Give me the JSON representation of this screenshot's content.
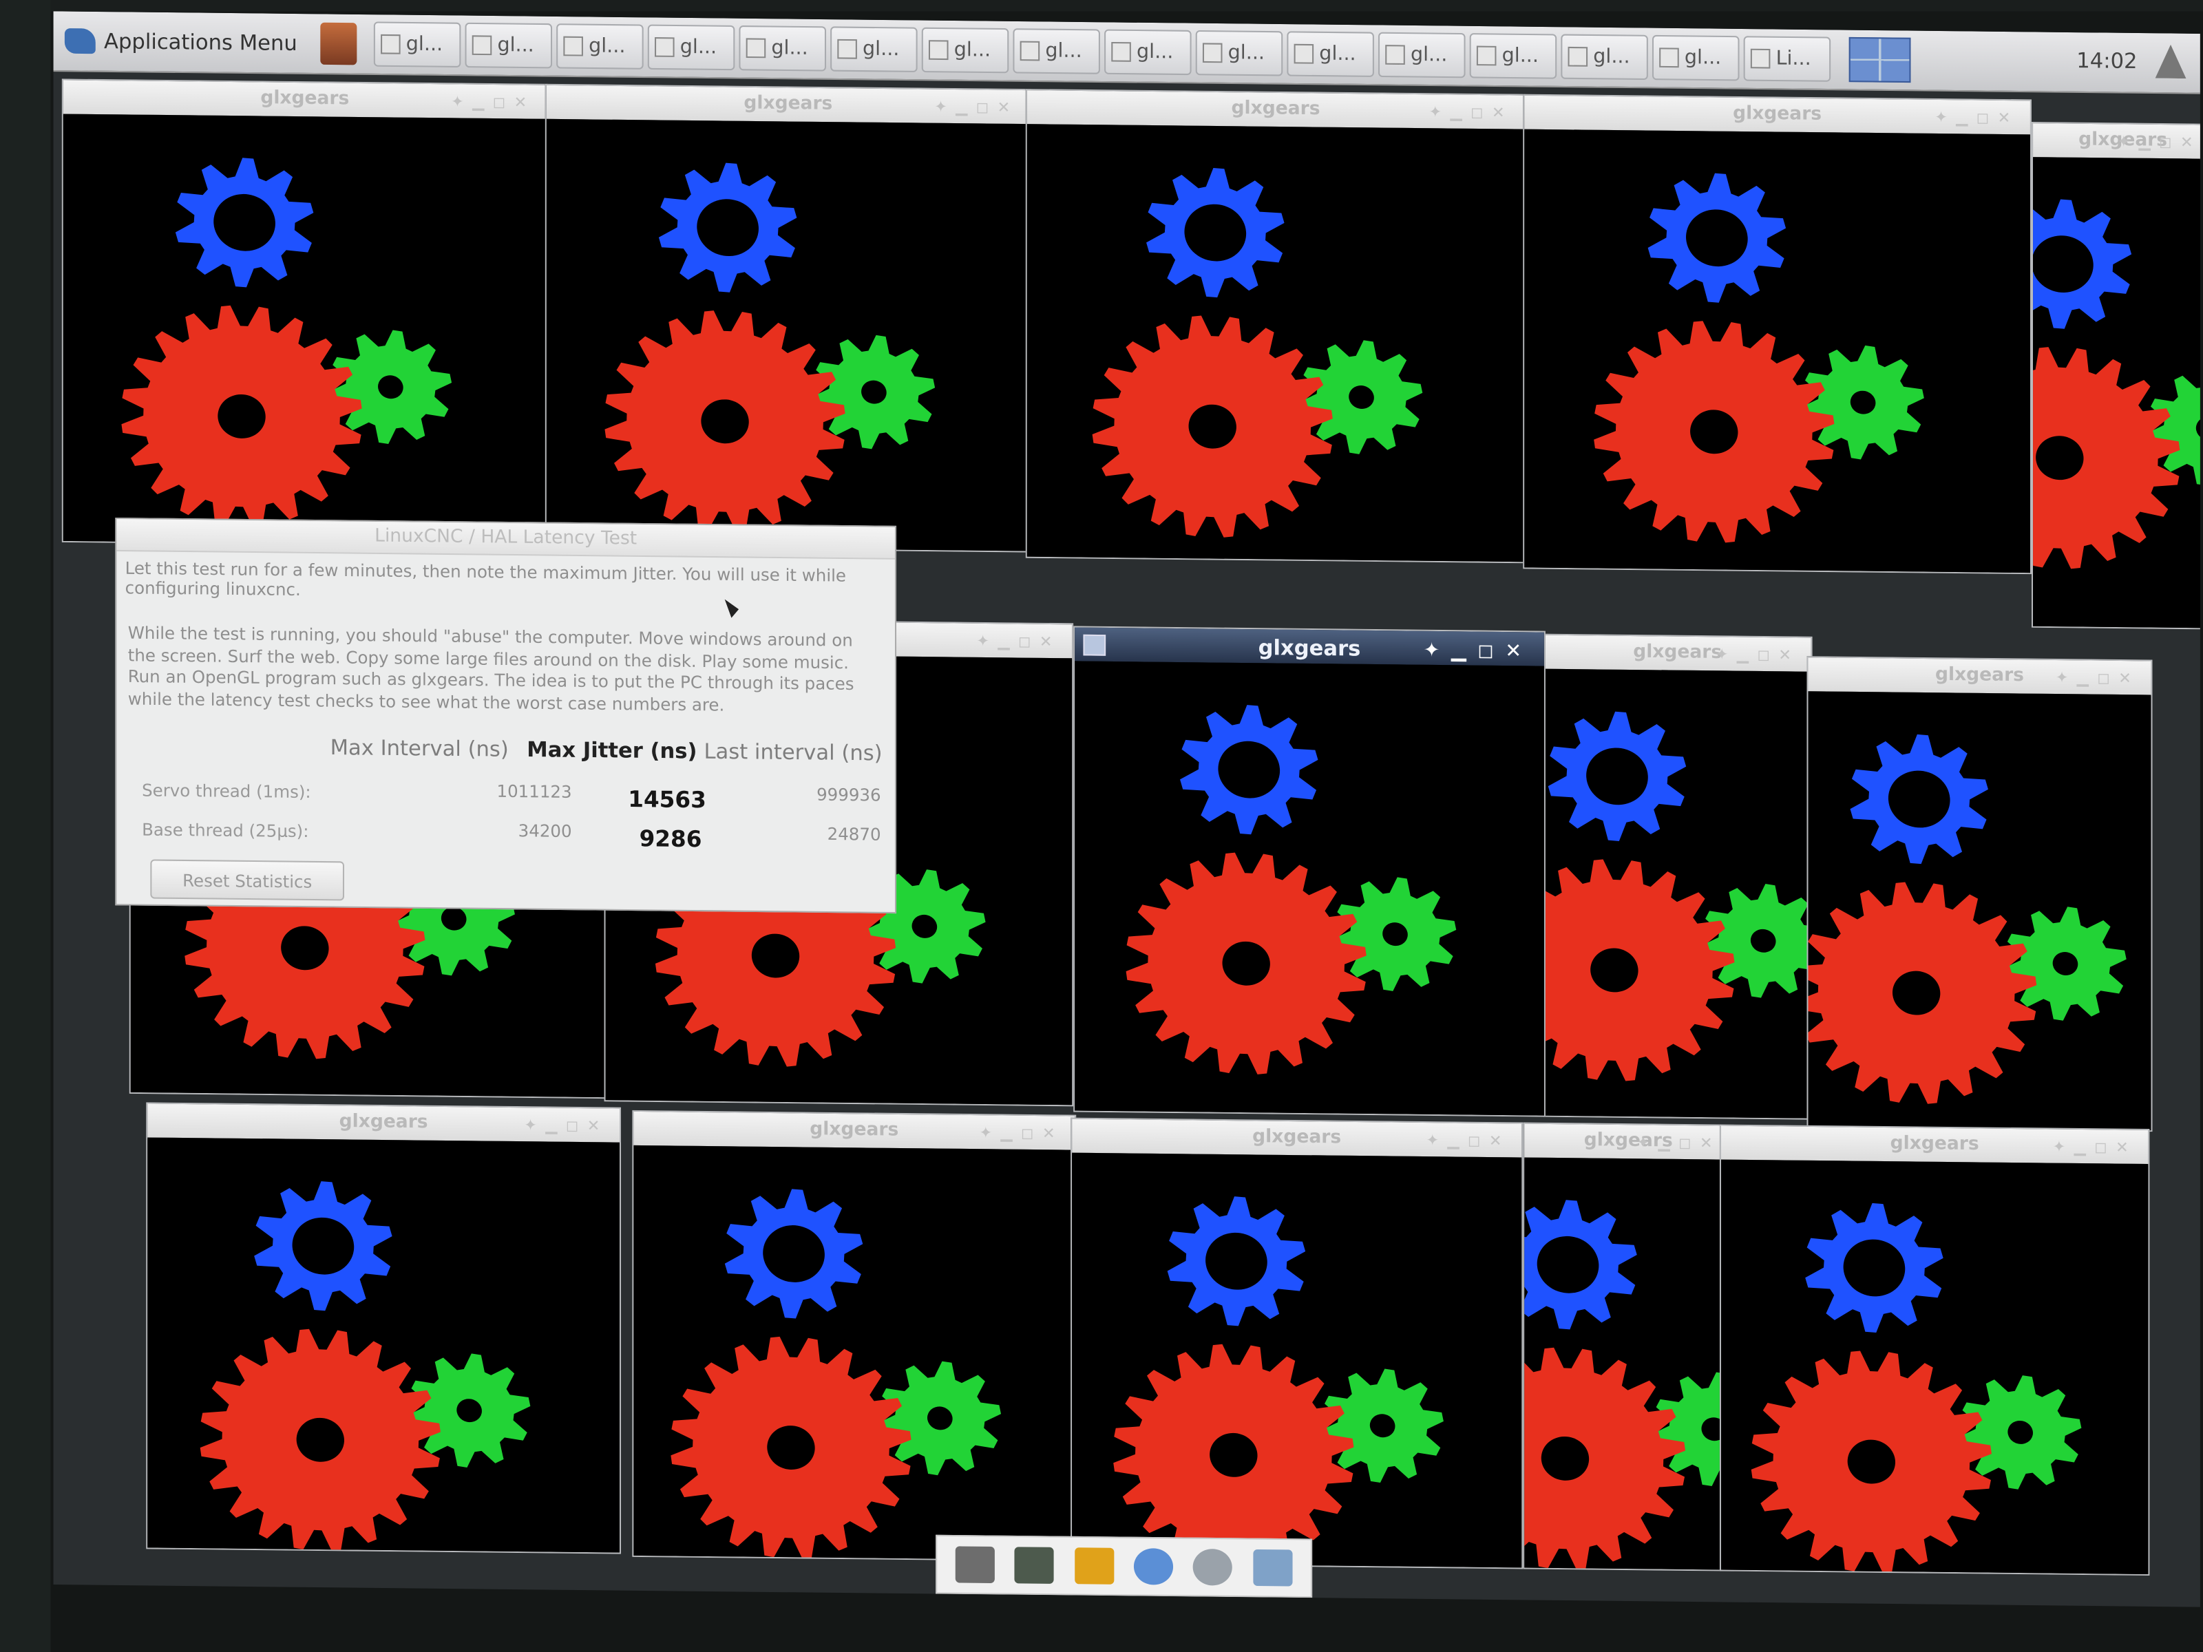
{
  "panel": {
    "app_menu_label": "Applications Menu",
    "tasks": [
      "gl...",
      "gl...",
      "gl...",
      "gl...",
      "gl...",
      "gl...",
      "gl...",
      "gl...",
      "gl...",
      "gl...",
      "gl...",
      "gl...",
      "gl...",
      "gl...",
      "gl...",
      "Li..."
    ],
    "clock": "14:02"
  },
  "windows": {
    "title": "glxgears",
    "partial_title": "glxgear"
  },
  "dialog": {
    "title": "LinuxCNC / HAL Latency Test",
    "intro": "Let this test run for a few minutes, then note the maximum Jitter. You will use it while configuring linuxcnc.",
    "abuse": "While the test is running, you should \"abuse\" the computer. Move windows around on the screen. Surf the web. Copy some large files around on the disk. Play some music. Run an OpenGL program such as glxgears. The idea is to put the PC through its paces while the latency test checks to see what the worst case numbers are.",
    "columns": {
      "max_interval": "Max Interval (ns)",
      "max_jitter": "Max Jitter (ns)",
      "last_interval": "Last interval (ns)"
    },
    "rows": [
      {
        "label": "Servo thread (1ms):",
        "max_interval": "1011123",
        "max_jitter": "14563",
        "last_interval": "999936"
      },
      {
        "label": "Base thread (25µs):",
        "max_interval": "34200",
        "max_jitter": "9286",
        "last_interval": "24870"
      }
    ],
    "reset_button": "Reset Statistics"
  },
  "colors": {
    "red_gear": "#e8301e",
    "green_gear": "#22d336",
    "blue_gear": "#1f52ff",
    "active_titlebar": "#33415c"
  },
  "dock_icons": [
    "terminal-icon",
    "display-icon",
    "files-icon",
    "web-browser-icon",
    "search-icon",
    "folder-icon"
  ]
}
